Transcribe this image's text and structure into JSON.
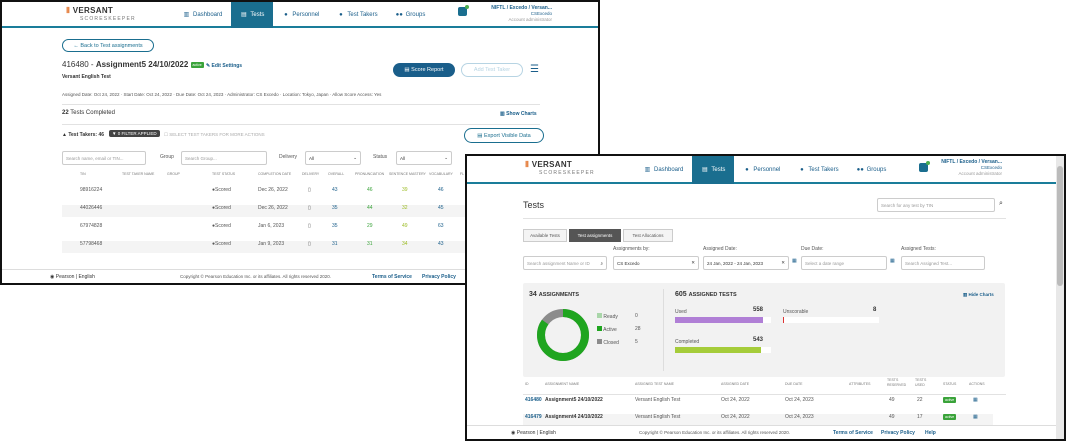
{
  "brand": {
    "name": "VERSANT",
    "sub": "SCORESKEEPER"
  },
  "nav": [
    "Dashboard",
    "Tests",
    "Personnel",
    "Test Takers",
    "Groups"
  ],
  "account": {
    "line1": "NIFTL / Excedo / Versan...",
    "line2": "CSExcedo",
    "line3": "Account administrator"
  },
  "w1": {
    "back": "Back to Test assignments",
    "assign_id": "416480 - ",
    "assign_name": "Assignment5 24/10/2022",
    "status": "active",
    "edit": "Edit Settings",
    "test_name": "Versant English Test",
    "score_report": "Score Report",
    "add_taker": "Add Test Taker",
    "meta": "Assigned Date: Oct 24, 2022 · Start Date: Oct 24, 2022 · Due Date: Oct 24, 2023 · Administrator: CS Excedo · Location: Tokyo, Japan · Allow Score Access: Yes",
    "completed_count": "22",
    "completed_label": "Tests Completed",
    "show_charts": "Show Charts",
    "takers": "Test Takers: 46",
    "filter": "0 FILTER APPLIED",
    "select_hint": "SELECT TEST TAKERS FOR MORE ACTIONS",
    "export": "Export Visible Data",
    "search_ph": "Search name, email or TIN...",
    "group_label": "Group",
    "group_ph": "Search Group...",
    "delivery_label": "Delivery",
    "delivery_val": "All",
    "status_label": "Status",
    "status_val": "All",
    "cols": [
      "TIN",
      "TEST TAKER NAME",
      "GROUP",
      "TEST STATUS",
      "COMPLETION DATE",
      "DELIVERY",
      "OVERALL",
      "PRONUNCIATION",
      "SENTENCE MASTERY",
      "VOCABULARY",
      "FL"
    ],
    "rows": [
      {
        "tin": "98916224",
        "status": "Scored",
        "date": "Dec 26, 2022",
        "o": "43",
        "p": "46",
        "s": "39",
        "v": "46"
      },
      {
        "tin": "44026446",
        "status": "Scored",
        "date": "Dec 26, 2022",
        "o": "35",
        "p": "44",
        "s": "32",
        "v": "45"
      },
      {
        "tin": "67974828",
        "status": "Scored",
        "date": "Jan 6, 2023",
        "o": "35",
        "p": "29",
        "s": "49",
        "v": "63"
      },
      {
        "tin": "57798468",
        "status": "Scored",
        "date": "Jan 9, 2023",
        "o": "31",
        "p": "31",
        "s": "34",
        "v": "43"
      }
    ],
    "lang": "Pearson | English",
    "copyright": "Copyright © Pearson Education Inc. or its affiliates. All rights reserved 2020.",
    "links": [
      "Terms of Service",
      "Privacy Policy"
    ]
  },
  "w2": {
    "title": "Tests",
    "search_ph": "Search for any test by TIN",
    "tabs": [
      "Available Tests",
      "Test assignments",
      "Test Allocations"
    ],
    "assignments_by": "Assignments by:",
    "assign_search_ph": "Search assignment Name or ID",
    "assignee": "CS Excedo",
    "assigned_date_label": "Assigned Date:",
    "assigned_date": "24 Jan, 2022 - 24 Jan, 2023",
    "due_label": "Due Date:",
    "due_ph": "Select a date range",
    "assigned_tests_label": "Assigned Tests:",
    "assigned_tests_ph": "Search Assigned Test...",
    "assignments_count": "34",
    "assignments_label": "ASSIGNMENTS",
    "legend": [
      {
        "label": "Ready",
        "value": "0"
      },
      {
        "label": "Active",
        "value": "28"
      },
      {
        "label": "Closed",
        "value": "5"
      }
    ],
    "donut": {
      "ready": 0,
      "active": 28,
      "closed": 5,
      "colors": {
        "active": "#1fa51f",
        "closed": "#8c8c8c",
        "ready": "#a9d6a9"
      }
    },
    "tests_count": "605",
    "tests_label": "ASSIGNED TESTS",
    "used_label": "Used",
    "used": "558",
    "used_frac": 0.92,
    "unscorable_label": "Unscorable",
    "unscorable": "8",
    "unscorable_frac": 0.01,
    "completed_label": "Completed",
    "completed": "543",
    "completed_frac": 0.9,
    "hide_charts": "Hide Charts",
    "cols": [
      "ID",
      "ASSIGNMENT NAME",
      "ASSIGNED TEST NAME",
      "ASSIGNED DATE",
      "DUE DATE",
      "ATTRIBUTES",
      "TESTS RESERVED",
      "TESTS USED",
      "STATUS",
      "ACTIONS"
    ],
    "rows": [
      {
        "id": "416480",
        "name": "Assignment5 24/10/2022",
        "test": "Versant English Test",
        "assigned": "Oct 24, 2022",
        "due": "Oct 24, 2023",
        "reserved": "49",
        "used": "22",
        "status": "active"
      },
      {
        "id": "416479",
        "name": "Assignment4 24/10/2022",
        "test": "Versant English Test",
        "assigned": "Oct 24, 2022",
        "due": "Oct 24, 2023",
        "reserved": "49",
        "used": "17",
        "status": "active"
      }
    ],
    "lang": "Pearson | English",
    "copyright": "Copyright © Pearson Education Inc. or its affiliates. All rights reserved 2020.",
    "links": [
      "Terms of Service",
      "Privacy Policy",
      "Help"
    ]
  }
}
